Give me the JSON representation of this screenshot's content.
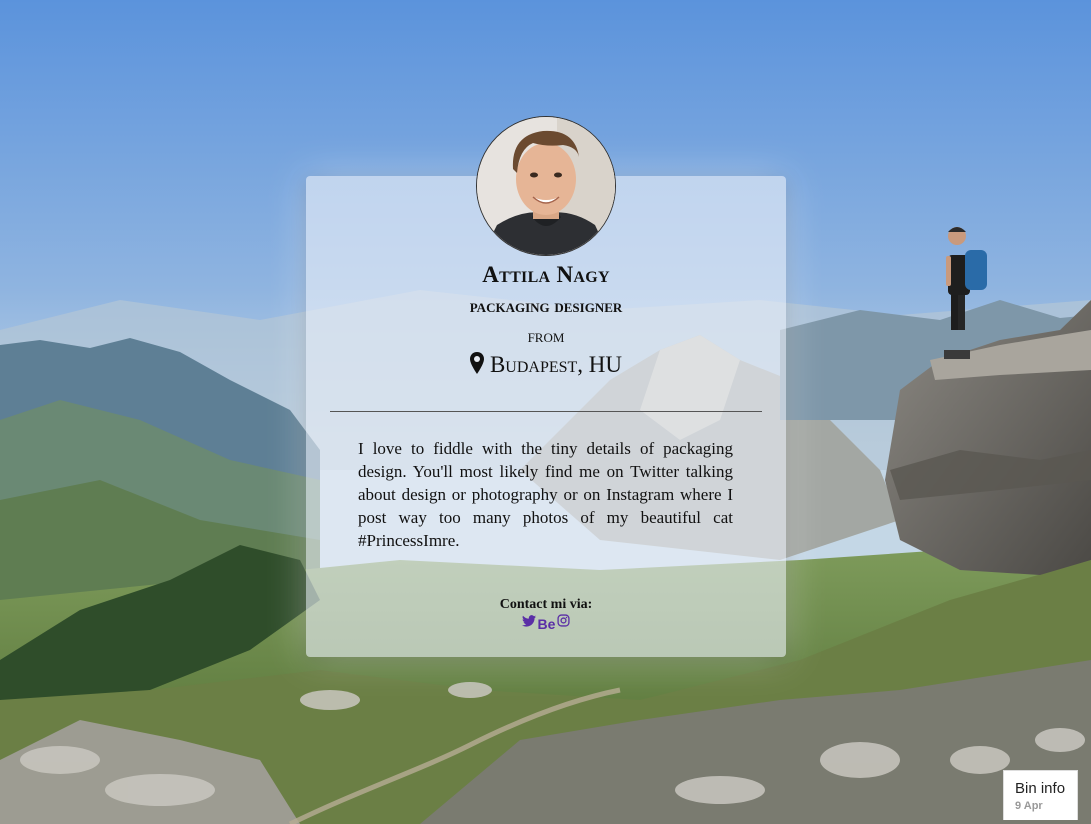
{
  "profile": {
    "name": "Attila Nagy",
    "role": "packaging designer",
    "from_label": "from",
    "location": "Budapest, HU",
    "bio": "I love to fiddle with the tiny details of packaging design. You'll most likely find me on Twitter talking about design or photography or on Instagram where I post way too many photos of my beautiful cat #PrincessImre."
  },
  "contact": {
    "label": "Contact mi via:",
    "links": [
      {
        "icon": "twitter-icon",
        "text": ""
      },
      {
        "icon": "behance-icon",
        "text": "Be"
      },
      {
        "icon": "instagram-icon",
        "text": ""
      }
    ]
  },
  "bin_info": {
    "title": "Bin info",
    "date": "9 Apr"
  },
  "colors": {
    "link": "#5a2ea6",
    "card_bg": "rgba(235,240,248,0.62)",
    "sky_top": "#5b93dc",
    "sky_horizon": "#c9dbe8"
  }
}
